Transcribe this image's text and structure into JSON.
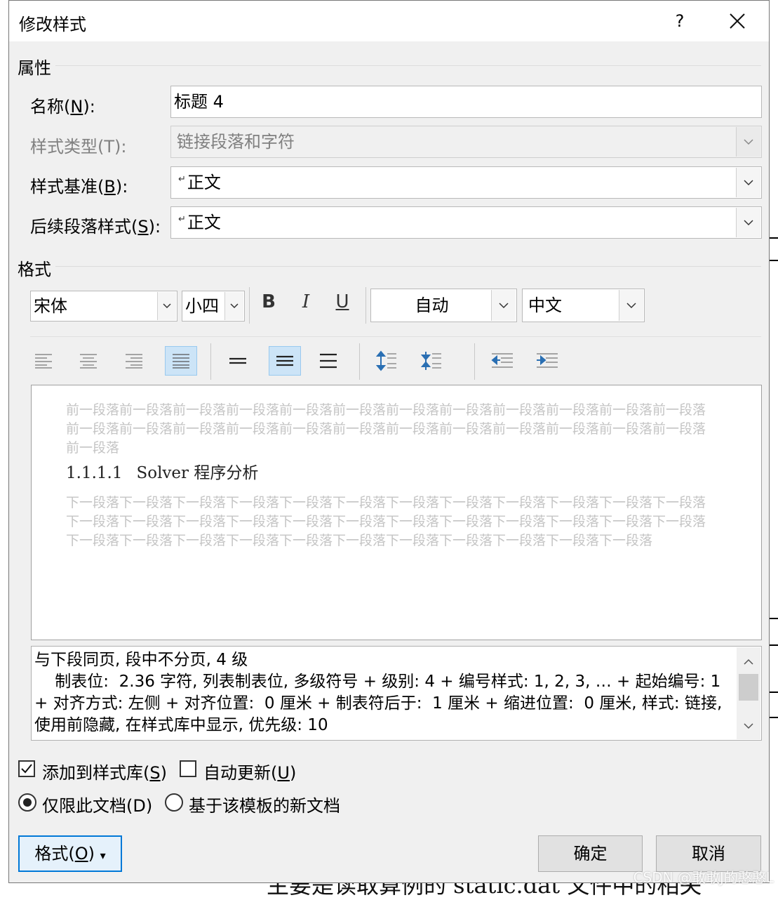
{
  "window": {
    "title": "修改样式",
    "help_label": "?"
  },
  "properties": {
    "section_title": "属性",
    "name_label": "名称(",
    "name_key": "N",
    "name_label_end": "):",
    "name_value": "标题 4",
    "style_type_label": "样式类型(T):",
    "style_type_value": "链接段落和字符",
    "based_on_label": "样式基准(",
    "based_on_key": "B",
    "based_on_label_end": "):",
    "based_on_value": "正文",
    "following_label": "后续段落样式(",
    "following_key": "S",
    "following_label_end": "):",
    "following_value": "正文",
    "paragraph_mark": "↵"
  },
  "format": {
    "section_title": "格式",
    "font": "宋体",
    "size": "小四",
    "bold_label": "B",
    "italic_label": "I",
    "underline_label": "U",
    "color": "自动",
    "script": "中文"
  },
  "preview": {
    "prev_paragraph": "前一段落前一段落前一段落前一段落前一段落前一段落前一段落前一段落前一段落前一段落前一段落前一段落前一段落前一段落前一段落前一段落前一段落前一段落前一段落前一段落前一段落前一段落前一段落前一段落前一段落",
    "heading_number": "1.1.1.1",
    "heading_text": "Solver 程序分析",
    "next_paragraph": "下一段落下一段落下一段落下一段落下一段落下一段落下一段落下一段落下一段落下一段落下一段落下一段落下一段落下一段落下一段落下一段落下一段落下一段落下一段落下一段落下一段落下一段落下一段落下一段落下一段落下一段落下一段落下一段落下一段落下一段落下一段落下一段落下一段落下一段落下一段落"
  },
  "description": {
    "line1": "与下段同页, 段中不分页, 4 级",
    "line2": "    制表位:  2.36 字符, 列表制表位, 多级符号 + 级别: 4 + 编号样式: 1, 2, 3, … + 起始编号: 1 + 对齐方式: 左侧 + 对齐位置:  0 厘米 + 制表符后于:  1 厘米 + 缩进位置:  0 厘米, 样式: 链接, 使用前隐藏, 在样式库中显示, 优先级: 10"
  },
  "options": {
    "add_to_gallery_label": "添加到样式库(",
    "add_to_gallery_key": "S",
    "add_to_gallery_end": ")",
    "add_to_gallery_checked": true,
    "auto_update_label": "自动更新(",
    "auto_update_key": "U",
    "auto_update_end": ")",
    "auto_update_checked": false,
    "this_doc_label": "仅限此文档(D)",
    "template_label": "基于该模板的新文档",
    "selected_scope": "this_doc"
  },
  "buttons": {
    "format_label": "格式(",
    "format_key": "O",
    "format_end": ")",
    "format_arrow": "▾",
    "ok_label": "确定",
    "cancel_label": "取消"
  },
  "background": {
    "bottom_text": "主要是读取算例的 static.dat 文件中的相关",
    "watermark": "CSDN @敢敢J的憨憨L"
  }
}
